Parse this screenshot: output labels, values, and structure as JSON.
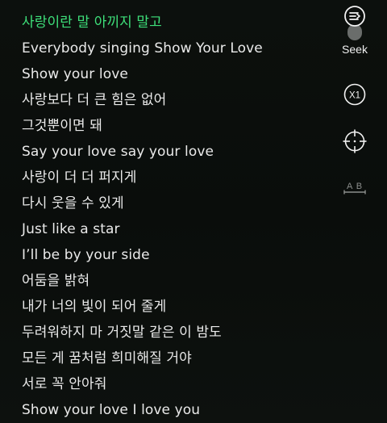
{
  "lyrics": {
    "lines": [
      "사랑이란 말 아끼지 말고",
      "Everybody singing Show Your Love",
      "Show your love",
      "사랑보다 더 큰 힘은 없어",
      "그것뿐이면 돼",
      "Say your love say your love",
      "사랑이 더 더 퍼지게",
      "다시 웃을 수 있게",
      "Just like a star",
      "I’ll be by your side",
      "어둠을 밝혀",
      "내가 너의 빛이 되어 줄게",
      "두려워하지 마 거짓말 같은 이 밤도",
      "모든 게 꿈처럼 희미해질 거야",
      "서로 꼭 안아줘",
      "Show your love I love you"
    ],
    "active_index": 0,
    "active_color": "#3ee07a"
  },
  "controls": {
    "seek_label": "Seek",
    "speed_label": "X1",
    "ab_label": "A B",
    "icons": [
      "playlist-icon",
      "seek-toggle",
      "speed-icon",
      "crosshair-icon",
      "ab-repeat-icon"
    ]
  }
}
